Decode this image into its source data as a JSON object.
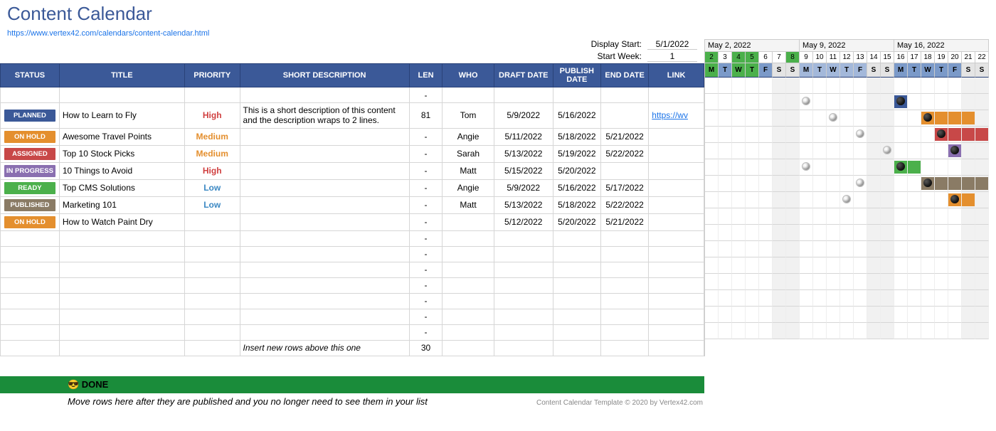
{
  "page": {
    "title": "Content Calendar",
    "source_url": "https://www.vertex42.com/calendars/content-calendar.html",
    "display_start_label": "Display Start:",
    "display_start_value": "5/1/2022",
    "start_week_label": "Start Week:",
    "start_week_value": "1"
  },
  "headers": {
    "status": "STATUS",
    "title": "TITLE",
    "priority": "PRIORITY",
    "desc": "SHORT DESCRIPTION",
    "len": "LEN",
    "who": "WHO",
    "draft": "DRAFT DATE",
    "publish": "PUBLISH DATE",
    "end": "END DATE",
    "link": "LINK"
  },
  "status_colors": {
    "PLANNED": "#3b5998",
    "ON HOLD": "#e48f2e",
    "ASSIGNED": "#c84848",
    "IN PROGRESS": "#8a6fb0",
    "READY": "#4bb04b",
    "PUBLISHED": "#8a7b65"
  },
  "rows": [
    {
      "status": "",
      "title": "",
      "priority": "",
      "desc": "",
      "len": "-",
      "who": "",
      "draft": "",
      "publish": "",
      "end": "",
      "link": ""
    },
    {
      "status": "PLANNED",
      "title": "How to Learn to Fly",
      "priority": "High",
      "desc": "This is a short description of this content and the description wraps to 2 lines.",
      "len": "81",
      "who": "Tom",
      "draft": "5/9/2022",
      "publish": "5/16/2022",
      "end": "",
      "link": "https://wv",
      "gantt": {
        "draft_col": 7,
        "pub_col": 14,
        "bar_start": 14,
        "bar_end": 14,
        "bar_color": "#3b5998"
      }
    },
    {
      "status": "ON HOLD",
      "title": "Awesome Travel Points",
      "priority": "Medium",
      "desc": "",
      "len": "-",
      "who": "Angie",
      "draft": "5/11/2022",
      "publish": "5/18/2022",
      "end": "5/21/2022",
      "gantt": {
        "draft_col": 9,
        "pub_col": 16,
        "bar_start": 16,
        "bar_end": 19,
        "bar_color": "#e48f2e"
      }
    },
    {
      "status": "ASSIGNED",
      "title": "Top 10 Stock Picks",
      "priority": "Medium",
      "desc": "",
      "len": "-",
      "who": "Sarah",
      "draft": "5/13/2022",
      "publish": "5/19/2022",
      "end": "5/22/2022",
      "gantt": {
        "draft_col": 11,
        "pub_col": 17,
        "bar_start": 17,
        "bar_end": 20,
        "bar_color": "#c84848"
      }
    },
    {
      "status": "IN PROGRESS",
      "title": "10 Things to Avoid",
      "priority": "High",
      "desc": "",
      "len": "-",
      "who": "Matt",
      "draft": "5/15/2022",
      "publish": "5/20/2022",
      "end": "",
      "gantt": {
        "draft_col": 13,
        "pub_col": 18,
        "bar_start": 18,
        "bar_end": 18,
        "bar_color": "#8a6fb0"
      }
    },
    {
      "status": "READY",
      "title": "Top CMS Solutions",
      "priority": "Low",
      "desc": "",
      "len": "-",
      "who": "Angie",
      "draft": "5/9/2022",
      "publish": "5/16/2022",
      "end": "5/17/2022",
      "gantt": {
        "draft_col": 7,
        "pub_col": 14,
        "bar_start": 14,
        "bar_end": 15,
        "bar_color": "#4bb04b"
      }
    },
    {
      "status": "PUBLISHED",
      "title": "Marketing 101",
      "priority": "Low",
      "desc": "",
      "len": "-",
      "who": "Matt",
      "draft": "5/13/2022",
      "publish": "5/18/2022",
      "end": "5/22/2022",
      "gantt": {
        "draft_col": 11,
        "pub_col": 16,
        "bar_start": 16,
        "bar_end": 20,
        "bar_color": "#8a7b65"
      }
    },
    {
      "status": "ON HOLD",
      "title": "How to Watch Paint Dry",
      "priority": "",
      "desc": "",
      "len": "-",
      "who": "",
      "draft": "5/12/2022",
      "publish": "5/20/2022",
      "end": "5/21/2022",
      "gantt": {
        "draft_col": 10,
        "pub_col": 18,
        "bar_start": 18,
        "bar_end": 19,
        "bar_color": "#e48f2e"
      }
    },
    {
      "status": "",
      "title": "",
      "priority": "",
      "desc": "",
      "len": "-",
      "who": "",
      "draft": "",
      "publish": "",
      "end": ""
    },
    {
      "status": "",
      "title": "",
      "priority": "",
      "desc": "",
      "len": "-",
      "who": "",
      "draft": "",
      "publish": "",
      "end": ""
    },
    {
      "status": "",
      "title": "",
      "priority": "",
      "desc": "",
      "len": "-",
      "who": "",
      "draft": "",
      "publish": "",
      "end": ""
    },
    {
      "status": "",
      "title": "",
      "priority": "",
      "desc": "",
      "len": "-",
      "who": "",
      "draft": "",
      "publish": "",
      "end": ""
    },
    {
      "status": "",
      "title": "",
      "priority": "",
      "desc": "",
      "len": "-",
      "who": "",
      "draft": "",
      "publish": "",
      "end": ""
    },
    {
      "status": "",
      "title": "",
      "priority": "",
      "desc": "",
      "len": "-",
      "who": "",
      "draft": "",
      "publish": "",
      "end": ""
    },
    {
      "status": "",
      "title": "",
      "priority": "",
      "desc": "",
      "len": "-",
      "who": "",
      "draft": "",
      "publish": "",
      "end": ""
    },
    {
      "status": "",
      "title": "",
      "priority": "",
      "desc": "Insert new rows above this one",
      "len": "30",
      "who": "",
      "draft": "",
      "publish": "",
      "end": "",
      "desc_italic": true
    }
  ],
  "gantt": {
    "months": [
      "May 2, 2022",
      "May 9, 2022",
      "May 16, 2022"
    ],
    "day_nums": [
      "2",
      "3",
      "4",
      "5",
      "6",
      "7",
      "8",
      "9",
      "10",
      "11",
      "12",
      "13",
      "14",
      "15",
      "16",
      "17",
      "18",
      "19",
      "20",
      "21",
      "22"
    ],
    "dow": [
      "M",
      "T",
      "W",
      "T",
      "F",
      "S",
      "S",
      "M",
      "T",
      "W",
      "T",
      "F",
      "S",
      "S",
      "M",
      "T",
      "W",
      "T",
      "F",
      "S",
      "S"
    ],
    "day_num_styles": [
      "hl-green",
      "",
      "hl-green",
      "hl-green",
      "",
      "",
      "hl-green",
      "",
      "",
      "",
      "",
      "",
      "",
      "",
      "",
      "",
      "",
      "",
      "",
      "",
      ""
    ],
    "dow_styles": [
      "hl-green",
      "hl-blue",
      "hl-green",
      "hl-green",
      "hl-blue",
      "hl-gray",
      "hl-gray",
      "hl-blue2",
      "hl-blue2",
      "hl-blue2",
      "hl-blue2",
      "hl-blue2",
      "hl-gray",
      "hl-gray",
      "hl-blue",
      "hl-blue",
      "hl-blue",
      "hl-blue",
      "hl-blue",
      "hl-gray",
      "hl-gray"
    ]
  },
  "done": {
    "label": "😎 DONE",
    "note": "Move rows here after they are published and you no longer need to see them in your list",
    "copyright": "Content Calendar Template © 2020 by Vertex42.com"
  }
}
